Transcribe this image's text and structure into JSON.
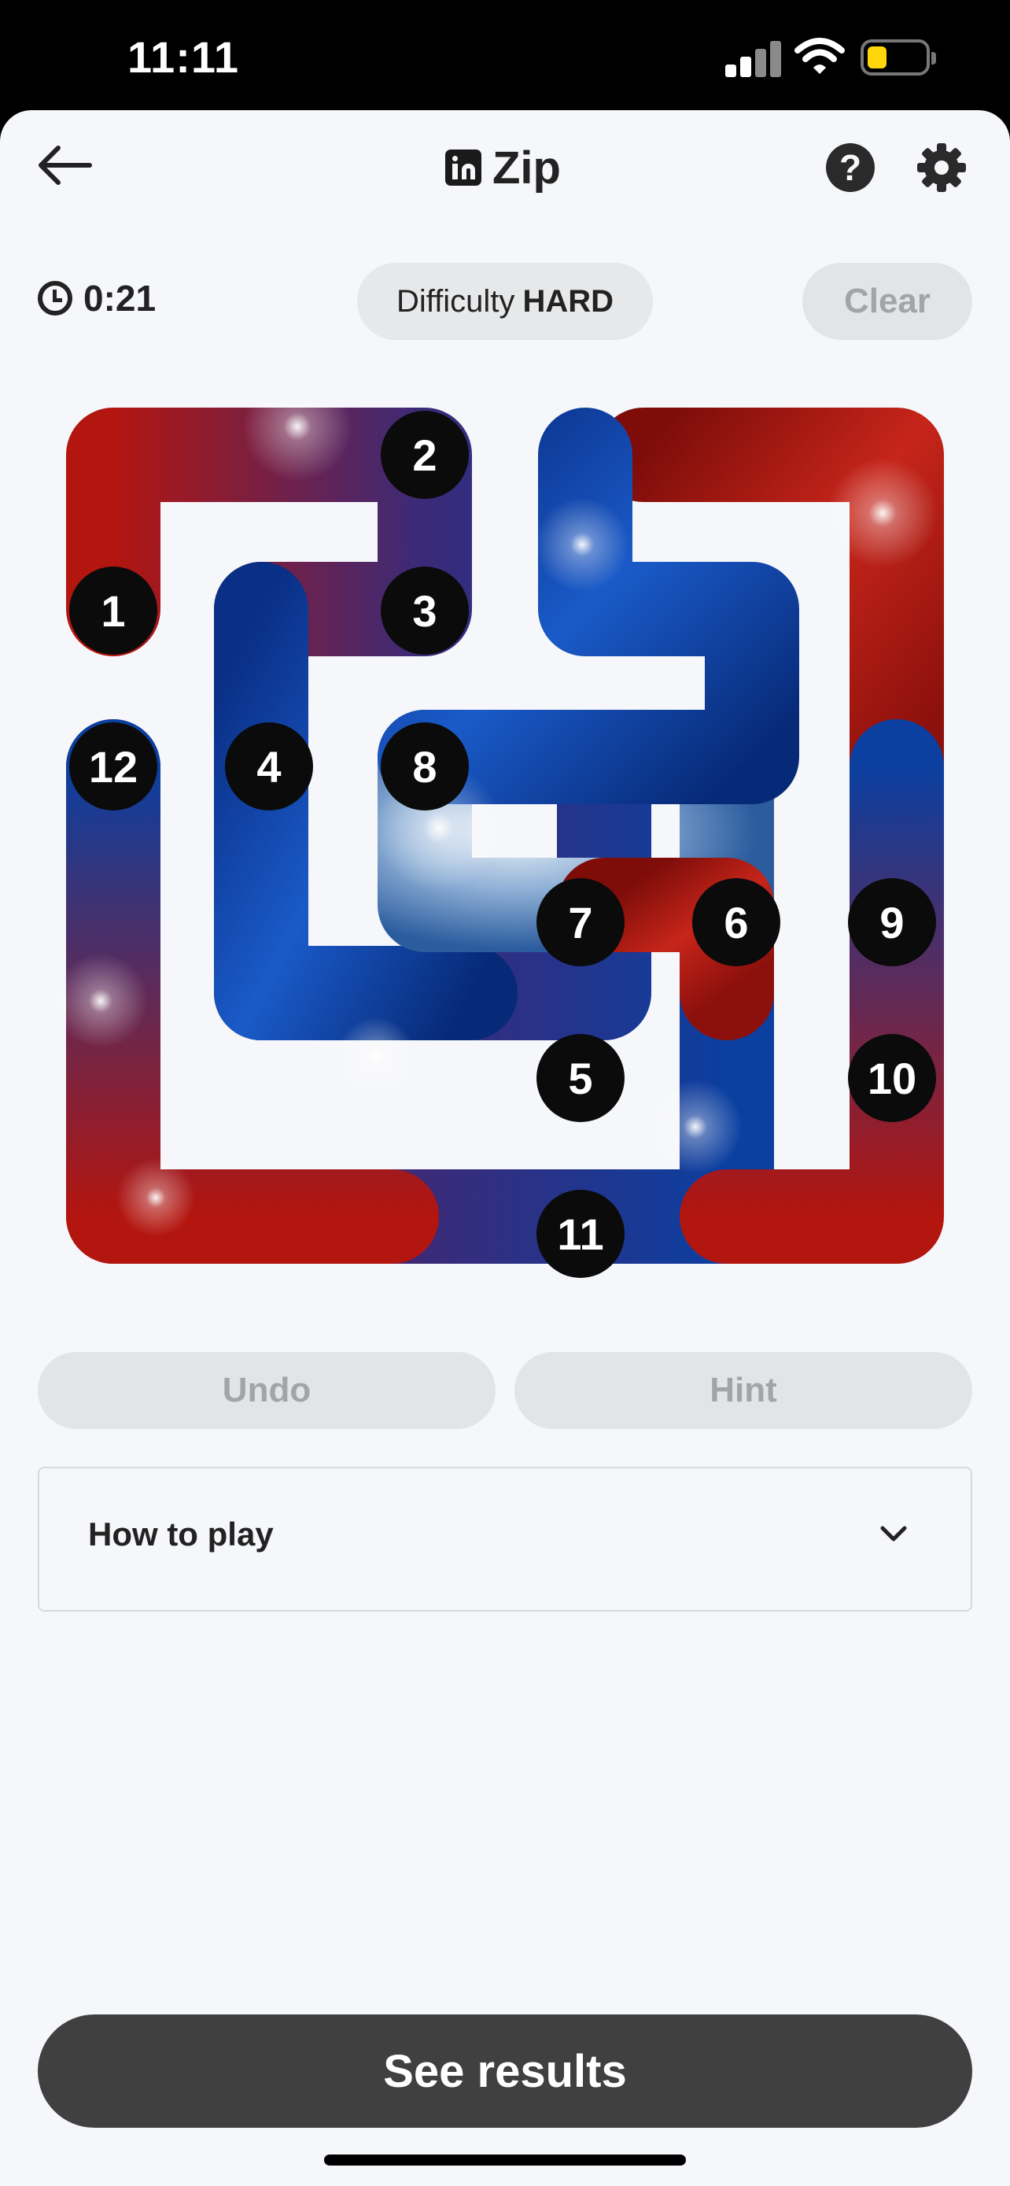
{
  "status_bar": {
    "time": "11:11"
  },
  "header": {
    "title": "Zip"
  },
  "toolbar": {
    "timer": "0:21",
    "difficulty_label": "Difficulty",
    "difficulty_value": "HARD",
    "clear_label": "Clear"
  },
  "puzzle": {
    "grid_size": 6,
    "waypoints": [
      {
        "label": "1",
        "row": 2,
        "col": 1
      },
      {
        "label": "2",
        "row": 1,
        "col": 3
      },
      {
        "label": "3",
        "row": 2,
        "col": 3
      },
      {
        "label": "4",
        "row": 3,
        "col": 2
      },
      {
        "label": "5",
        "row": 5,
        "col": 4
      },
      {
        "label": "6",
        "row": 4,
        "col": 5
      },
      {
        "label": "7",
        "row": 4,
        "col": 4
      },
      {
        "label": "8",
        "row": 3,
        "col": 3
      },
      {
        "label": "9",
        "row": 4,
        "col": 6
      },
      {
        "label": "10",
        "row": 5,
        "col": 6
      },
      {
        "label": "11",
        "row": 6,
        "col": 4
      },
      {
        "label": "12",
        "row": 3,
        "col": 1
      }
    ]
  },
  "actions": {
    "undo_label": "Undo",
    "hint_label": "Hint"
  },
  "how_to_play": {
    "label": "How to play"
  },
  "footer": {
    "results_label": "See results"
  },
  "colors": {
    "red": "#b3150f",
    "blue": "#0b3fa0",
    "light": "#d6e4f2",
    "background": "#f6f7fa"
  }
}
